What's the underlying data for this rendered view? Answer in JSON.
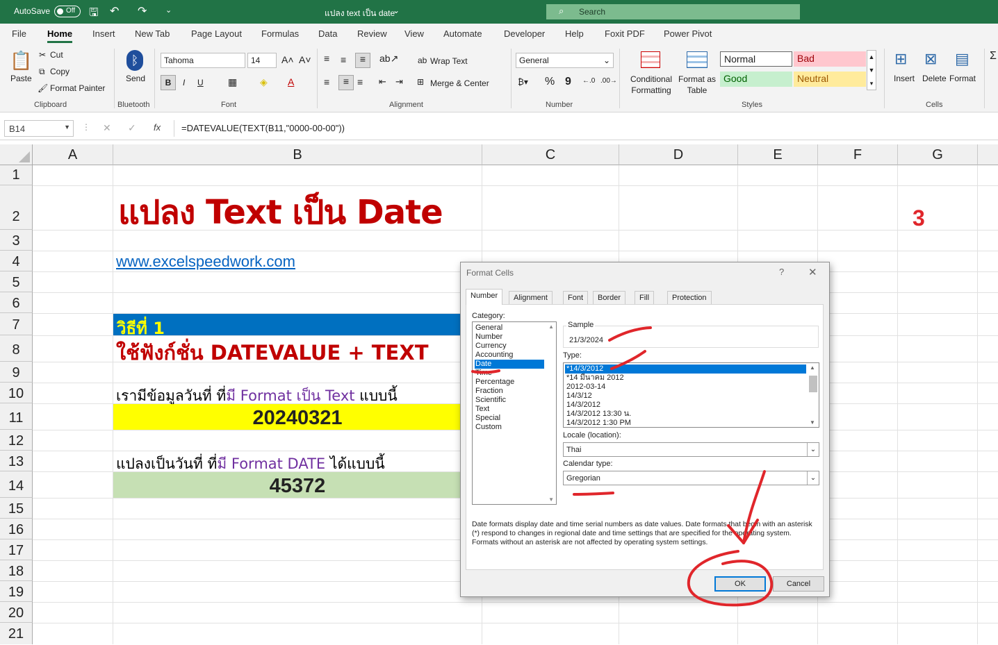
{
  "titlebar": {
    "autosave_label": "AutoSave",
    "autosave_state": "Off",
    "doc_title": "แปลง text เป็น date",
    "search_placeholder": "Search"
  },
  "menu": [
    "File",
    "Home",
    "Insert",
    "New Tab",
    "Page Layout",
    "Formulas",
    "Data",
    "Review",
    "View",
    "Automate",
    "Developer",
    "Help",
    "Foxit PDF",
    "Power Pivot"
  ],
  "ribbon": {
    "clipboard": {
      "paste": "Paste",
      "cut": "Cut",
      "copy": "Copy",
      "format_painter": "Format Painter",
      "label": "Clipboard"
    },
    "bluetooth": {
      "send": "Send",
      "label": "Bluetooth"
    },
    "font": {
      "name": "Tahoma",
      "size": "14",
      "bold": "B",
      "italic": "I",
      "underline": "U",
      "label": "Font"
    },
    "alignment": {
      "wrap": "Wrap Text",
      "merge": "Merge & Center",
      "label": "Alignment"
    },
    "number": {
      "format": "General",
      "percent": "%",
      "comma": "9",
      "label": "Number"
    },
    "styles": {
      "conditional": "Conditional Formatting",
      "format_table": "Format as Table",
      "normal": "Normal",
      "bad": "Bad",
      "good": "Good",
      "neutral": "Neutral",
      "label": "Styles"
    },
    "cells": {
      "insert": "Insert",
      "delete": "Delete",
      "format": "Format",
      "label": "Cells"
    }
  },
  "formulabar": {
    "namebox": "B14",
    "fx": "fx",
    "formula": "=DATEVALUE(TEXT(B11,\"0000-00-00\"))"
  },
  "columns": [
    "A",
    "B",
    "C",
    "D",
    "E",
    "F",
    "G"
  ],
  "rows": [
    "1",
    "2",
    "3",
    "4",
    "5",
    "6",
    "7",
    "8",
    "9",
    "10",
    "11",
    "12",
    "13",
    "14",
    "15",
    "16",
    "17",
    "18",
    "19",
    "20",
    "21"
  ],
  "cells": {
    "b2": "แปลง Text เป็น Date",
    "g2": "3",
    "b4": "www.excelspeedwork.com",
    "b7": "วิธีที่ 1",
    "b8": "ใช้ฟังก์ชั่น DATEVALUE + TEXT",
    "b10_pre": "เรามีข้อมูลวันที่ ที่",
    "b10_mid": "มี Format เป็น Text",
    "b10_post": " แบบนี้",
    "b11": "20240321",
    "b13_pre": "แปลงเป็นวันที่ ที่",
    "b13_mid": "มี Format  DATE",
    "b13_post": " ได้แบบนี้",
    "b14": "45372"
  },
  "dialog": {
    "title": "Format Cells",
    "help": "?",
    "close": "✕",
    "tabs": [
      "Number",
      "Alignment",
      "Font",
      "Border",
      "Fill",
      "Protection"
    ],
    "category_label": "Category:",
    "categories": [
      "General",
      "Number",
      "Currency",
      "Accounting",
      "Date",
      "Time",
      "Percentage",
      "Fraction",
      "Scientific",
      "Text",
      "Special",
      "Custom"
    ],
    "selected_category": "Date",
    "sample_label": "Sample",
    "sample_value": "21/3/2024",
    "type_label": "Type:",
    "types": [
      "*14/3/2012",
      "*14 มีนาคม 2012",
      "2012-03-14",
      "14/3/12",
      "14/3/2012",
      "14/3/2012 13:30 น.",
      "14/3/2012 1:30 PM"
    ],
    "locale_label": "Locale (location):",
    "locale_value": "Thai",
    "calendar_label": "Calendar type:",
    "calendar_value": "Gregorian",
    "description": "Date formats display date and time serial numbers as date values.  Date formats that begin with an asterisk (*) respond to changes in regional date and time settings that are specified for the operating system. Formats without an asterisk are not affected by operating system settings.",
    "ok": "OK",
    "cancel": "Cancel"
  },
  "colors": {
    "excel_green": "#217346",
    "title_red": "#c00000",
    "purple": "#7030a0",
    "header_blue": "#0070c0",
    "method_yellow": "#ffff00",
    "result_green": "#c6e0b4",
    "annotation_red": "#e0262b"
  }
}
